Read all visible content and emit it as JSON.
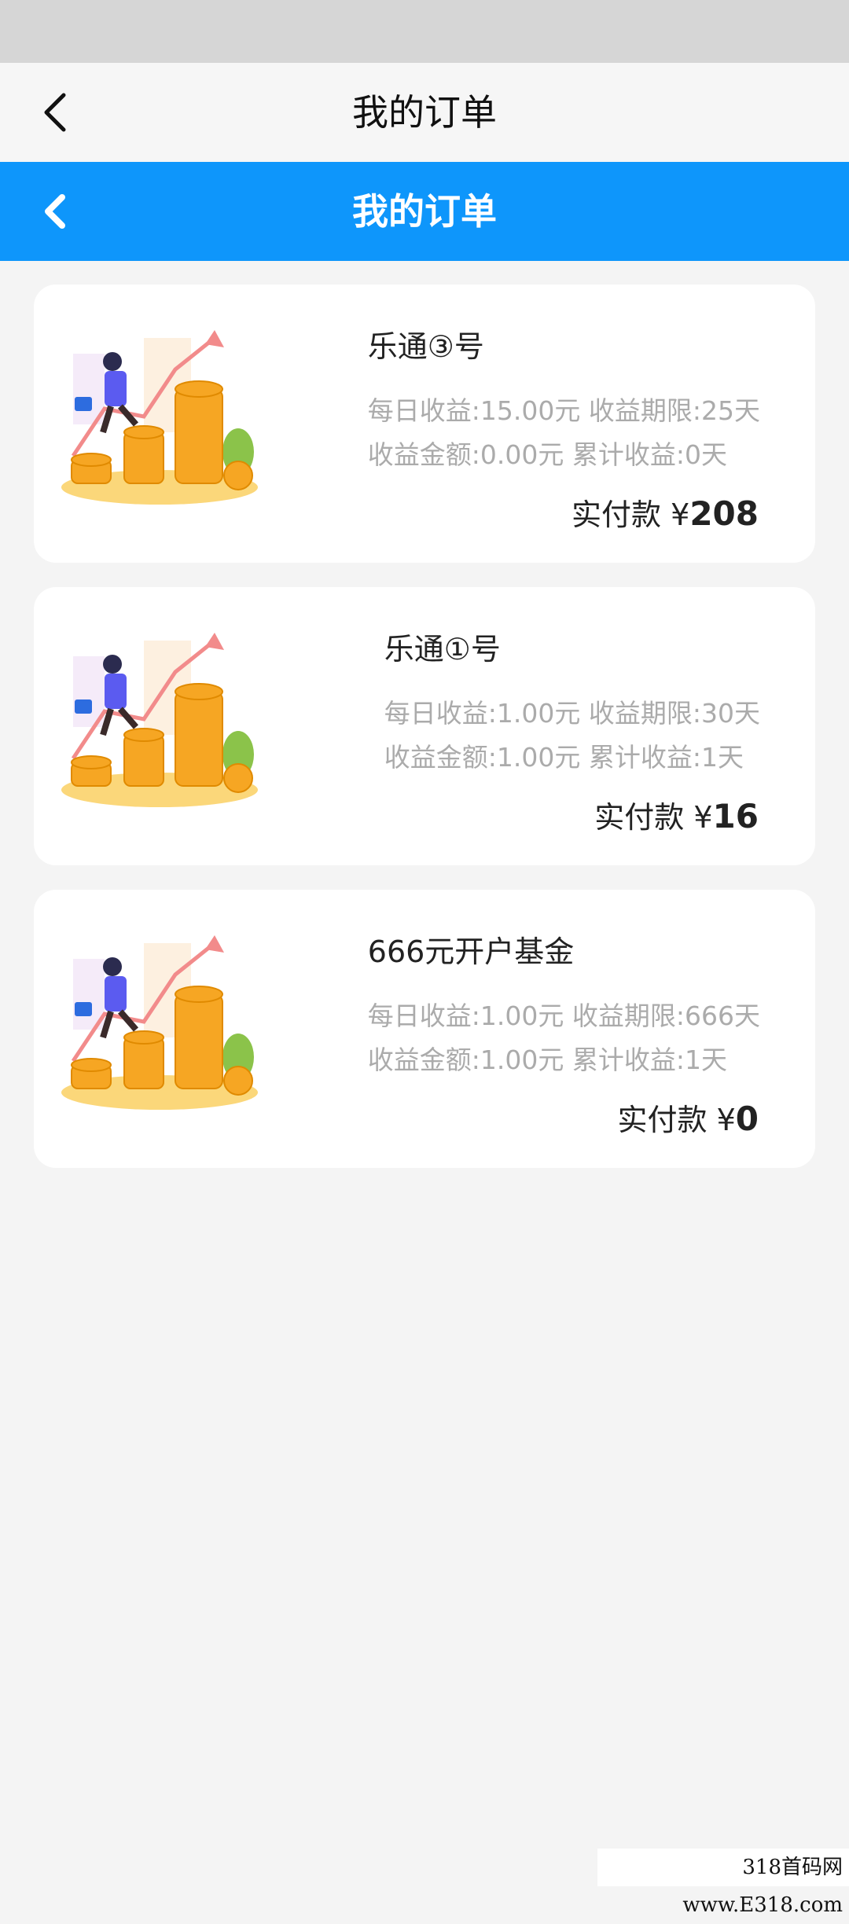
{
  "app_bar": {
    "title": "我的订单"
  },
  "blue_bar": {
    "title": "我的订单"
  },
  "orders": [
    {
      "name": "乐通③号",
      "daily_income": "每日收益:15.00元",
      "term": "收益期限:25天",
      "income_amount": "收益金额:0.00元",
      "cumulative": "累计收益:0天",
      "pay_label": "实付款",
      "currency": "¥",
      "amount": "208"
    },
    {
      "name": "乐通①号",
      "daily_income": "每日收益:1.00元",
      "term": "收益期限:30天",
      "income_amount": "收益金额:1.00元",
      "cumulative": "累计收益:1天",
      "pay_label": "实付款",
      "currency": "¥",
      "amount": "16"
    },
    {
      "name": "666元开户基金",
      "daily_income": "每日收益:1.00元",
      "term": "收益期限:666天",
      "income_amount": "收益金额:1.00元",
      "cumulative": "累计收益:1天",
      "pay_label": "实付款",
      "currency": "¥",
      "amount": "0"
    }
  ],
  "watermark": "318首码网 www.E318.com",
  "icons": {
    "back": "chevron-left-icon",
    "illustration": "coin-growth-illustration"
  },
  "colors": {
    "accent": "#0e96fb",
    "coin": "#f6a623"
  }
}
